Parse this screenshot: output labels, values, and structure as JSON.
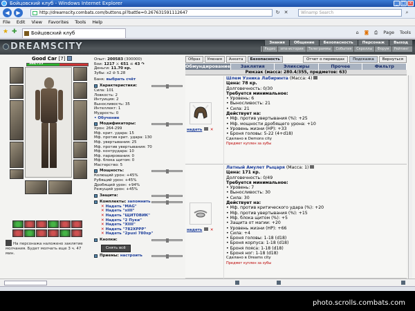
{
  "browser": {
    "title": "Бойцовский клуб - Windows Internet Explorer",
    "url": "http://dreamscity.combats.com/buttons.pl?battle=0.267631591112647",
    "search_placeholder": "Winamp Search",
    "menu": [
      "File",
      "Edit",
      "View",
      "Favorites",
      "Tools",
      "Help"
    ],
    "tab_title": "Бойцовский клуб",
    "tools": [
      "Page",
      "Tools"
    ]
  },
  "game": {
    "logo": "DREAMSCITY",
    "menu_top": [
      "Знания",
      "Общение",
      "Безопасность",
      "Персонаж",
      "Выход"
    ],
    "menu_sub": [
      "Радио",
      "sms-история",
      "Телеграммы",
      "События",
      "Скроллы",
      "Форум",
      "Рейтинг"
    ]
  },
  "character": {
    "name": "Good Car",
    "level": "[7]",
    "hp": "384/725",
    "hp_fraction": 0.53,
    "spell_note": "На персонажа наложено заклятие молчания. Будет молчать еще 3 ч. 47 мин."
  },
  "stats": {
    "lines_top": [
      [
        "Опыт:",
        "200583",
        "(300000)"
      ],
      [
        "Бои:",
        "1217 ⚔ 651 ☠ 43 ↷",
        ""
      ],
      [
        "Деньги:",
        "11.70 кр.",
        ""
      ],
      [
        "Зубы:",
        "x2 ⊘ 5.28",
        ""
      ]
    ],
    "bank_label": "Банк:",
    "bank_link": "выбрать счёт",
    "char_head": "Характеристики:",
    "attrs": [
      "Сила: 101",
      "Ловкость: 2",
      "Интуиция: 2",
      "Выносливость: 35",
      "Интеллект: 1",
      "Мудрость: 0"
    ],
    "training_link": "• Обучение",
    "mod_head": "Модификаторы:",
    "mods": [
      "Урон: 264-299",
      "Мф. крит. удара: 15",
      "Мф. против крит. удара: 130",
      "Мф. увертывания: 25",
      "Мф. против увертывания: 70",
      "Мф. контрудара: 10",
      "Мф. парирования: 0",
      "Мф. блока щитом: 0",
      "Мастерство: 5"
    ],
    "power_head": "Мощность:",
    "powers": [
      "Колющий урон: +45%",
      "Рубящий урон: +45%",
      "Дробящий урон: +94%",
      "Режущий урон: +45%"
    ],
    "defense_head": "Защита:",
    "kits_head": "Комплекты:",
    "kits_remember": "запомнить",
    "kits": [
      {
        "link": "Надеть",
        "name": "\"MAG\""
      },
      {
        "link": "Надеть",
        "name": "\"xilll\""
      },
      {
        "link": "Надеть",
        "name": "\"ЩИТОВИК\""
      },
      {
        "link": "Надеть",
        "name": "\"2 Пуки\""
      },
      {
        "link": "Надеть",
        "name": "\"XIIII\""
      },
      {
        "link": "Надеть",
        "name": "\"782XPPP\""
      },
      {
        "link": "Надеть",
        "name": "\"2puxi 780xp\""
      }
    ],
    "buttons_head": "Кнопки:",
    "undress_label": "Снять всё",
    "tricks_head": "Приемы:",
    "tricks_link": "настроить"
  },
  "right": {
    "top_buttons": [
      "Образ",
      "Умения",
      "Анкета",
      "Безопасность"
    ],
    "top_buttons2": [
      "Отчет о переводах",
      "Подсказка",
      "Вернуться"
    ],
    "tabs": [
      "Обмундирование",
      "Заклятия",
      "Эликсиры",
      "Прочее",
      "Фильтр"
    ],
    "bag": "Рюкзак (масса: 280.4/355, предметов: 63)"
  },
  "items": [
    {
      "wear": "надеть",
      "name": "Шлем Узника Лабиринта",
      "mass": "(Масса: 4)",
      "lines": [
        "Цена: 78 кр.",
        "Долговечность: 0/30"
      ],
      "req_head": "Требуется минимальное:",
      "reqs": [
        "Уровень: 6",
        "Выносливость: 21",
        "Сила: 21"
      ],
      "act_head": "Действует на:",
      "acts": [
        "Мф. против увертывания (%): +25",
        "Мф. мощности дробящего урона: +10",
        "Уровень жизни (HP): +33",
        "Броня головы: 5-22 (4+d18)"
      ],
      "made": "Сделано в Demons city",
      "bought": "Предмет куплен за зубы"
    },
    {
      "wear": "надеть",
      "name": "Латный Амулет Рыцаря",
      "mass": "(Масса: 1)",
      "lines": [
        "Цена: 171 кр.",
        "Долговечность: 0/49"
      ],
      "req_head": "Требуется минимальное:",
      "reqs": [
        "Уровень: 7",
        "Выносливость: 30",
        "Сила: 30"
      ],
      "act_head": "Действует на:",
      "acts": [
        "Мф. против критического удара (%): +20",
        "Мф. против увертывания (%): +15",
        "Мф. блока щитом (%): +5",
        "Защита от магии: +20",
        "Уровень жизни (HP): +66",
        "Сила: +4",
        "Броня головы: 1-18 (d18)",
        "Броня корпуса: 1-18 (d18)",
        "Броня пояса: 1-18 (d18)",
        "Броня ног: 1-18 (d18)"
      ],
      "made": "Сделано в Dreams city",
      "bought": "Предмет куплен за зубы"
    }
  ],
  "watermark": "photo.scrolls.combats.com"
}
